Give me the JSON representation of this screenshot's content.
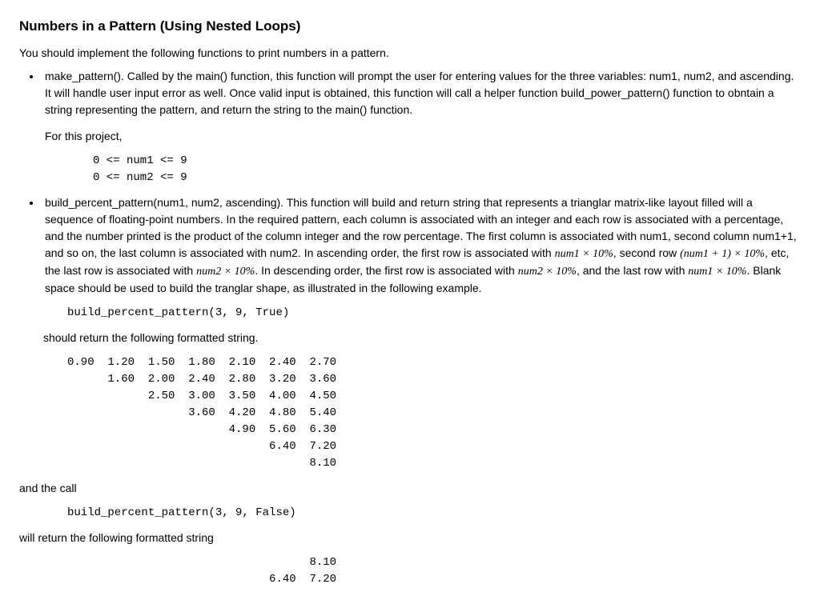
{
  "title": "Numbers in a Pattern (Using Nested Loops)",
  "intro": "You should implement the following functions to print numbers in a pattern.",
  "bullets": {
    "make_pattern": "make_pattern(). Called by the main() function, this function will prompt the user for entering values for the three variables: num1, num2, and ascending. It will handle user input error as well. Once valid input is obtained, this function will call a helper function build_power_pattern() function to obntain a string representing the pattern, and return the string to the main() function.",
    "for_project": "For this project,",
    "constraints": "0 <= num1 <= 9\n0 <= num2 <= 9",
    "build_pattern_pre": "build_percent_pattern(num1, num2, ascending). This function will build and return string that represents a trianglar matrix-like layout filled will a sequence of floating-point numbers. In the required pattern, each column is associated with an integer and each row is associated with a percentage, and the number printed is the product of the column integer and the row percentage. The first column is associated with num1, second column num1+1, and so on, the last column is associated with num2. In ascending order, the first row is associated with ",
    "math1": "num1 × 10%",
    "build_pattern_mid1": ", second row ",
    "math2": "(num1 + 1) × 10%",
    "build_pattern_mid2": ", etc, the last row is associated with ",
    "math3": "num2 × 10%",
    "build_pattern_mid3": ". In descending order, the first row is associated with ",
    "math4": "num2 × 10%",
    "build_pattern_mid4": ", and the last row with ",
    "math5": "num1 × 10%",
    "build_pattern_post": ". Blank space should be used to build the tranglar shape, as illustrated in the following example."
  },
  "call1_label": "build_percent_pattern(3, 9, True)",
  "should_return": "should return the following formatted string.",
  "output1": "0.90  1.20  1.50  1.80  2.10  2.40  2.70\n      1.60  2.00  2.40  2.80  3.20  3.60\n            2.50  3.00  3.50  4.00  4.50\n                  3.60  4.20  4.80  5.40\n                        4.90  5.60  6.30\n                              6.40  7.20\n                                    8.10",
  "and_call": "and the call",
  "call2_label": "build_percent_pattern(3, 9, False)",
  "will_return": "will return the following formatted string",
  "output2": "                                    8.10\n                              6.40  7.20",
  "chart_data": {
    "type": "table",
    "description": "Triangular percent-pattern outputs for build_percent_pattern(3, 9, ascending)",
    "ascending_rows": [
      [
        0.9,
        1.2,
        1.5,
        1.8,
        2.1,
        2.4,
        2.7
      ],
      [
        null,
        1.6,
        2.0,
        2.4,
        2.8,
        3.2,
        3.6
      ],
      [
        null,
        null,
        2.5,
        3.0,
        3.5,
        4.0,
        4.5
      ],
      [
        null,
        null,
        null,
        3.6,
        4.2,
        4.8,
        5.4
      ],
      [
        null,
        null,
        null,
        null,
        4.9,
        5.6,
        6.3
      ],
      [
        null,
        null,
        null,
        null,
        null,
        6.4,
        7.2
      ],
      [
        null,
        null,
        null,
        null,
        null,
        null,
        8.1
      ]
    ],
    "descending_rows_visible": [
      [
        null,
        null,
        null,
        null,
        null,
        null,
        8.1
      ],
      [
        null,
        null,
        null,
        null,
        null,
        6.4,
        7.2
      ]
    ]
  }
}
